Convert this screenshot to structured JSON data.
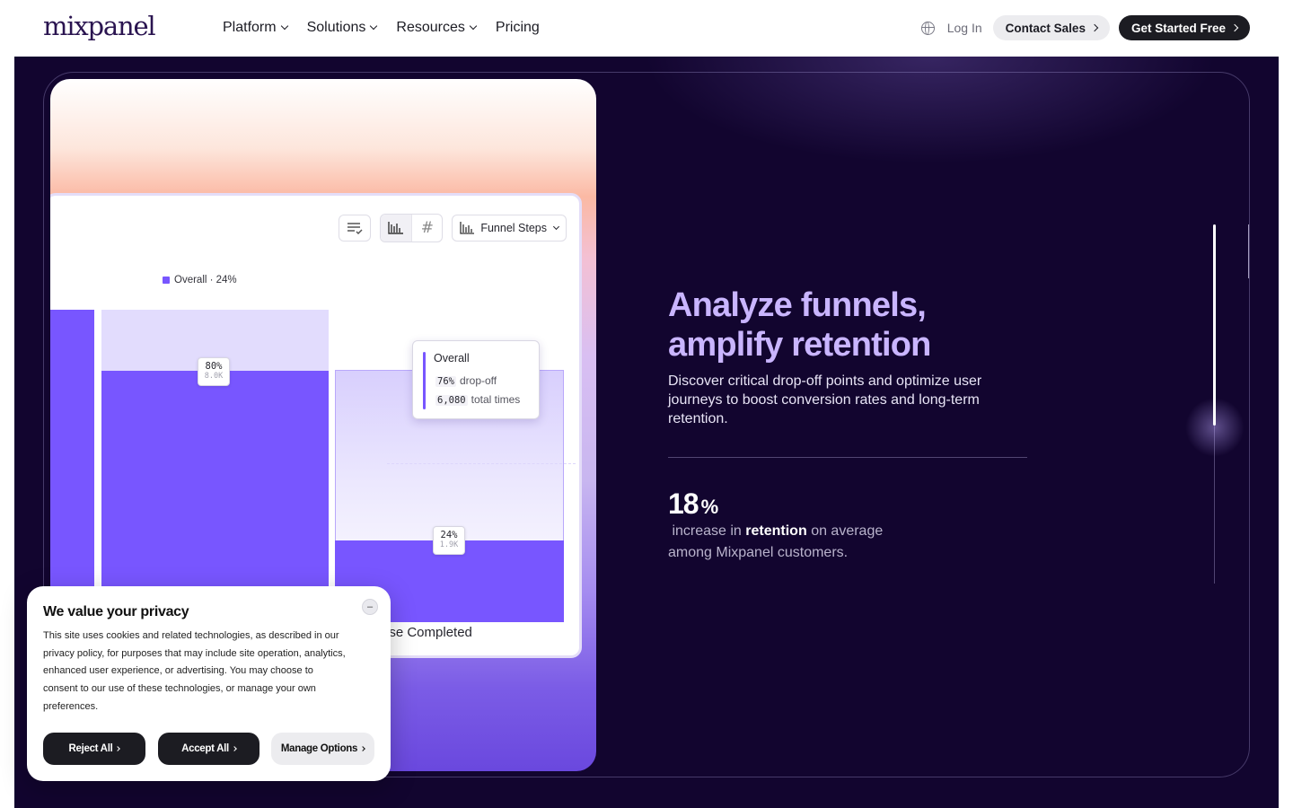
{
  "nav": {
    "logo": "mixpanel",
    "menu": [
      {
        "label": "Platform"
      },
      {
        "label": "Solutions"
      },
      {
        "label": "Resources"
      },
      {
        "label": "Pricing"
      }
    ],
    "login": "Log In",
    "contact": "Contact Sales",
    "start": "Get Started Free"
  },
  "chart": {
    "toolbar_select": "Funnel Steps",
    "legend": "Overall · 24%",
    "bar1_pct": "80%",
    "bar1_count": "8.0K",
    "bar2_pct": "24%",
    "bar2_count": "1.9K",
    "step_label": "ase Completed",
    "tooltip": {
      "title": "Overall",
      "dropoff_value": "76%",
      "dropoff_label": "drop-off",
      "total_value": "6,080",
      "total_label": "total times"
    }
  },
  "hero": {
    "title_line1": "Analyze funnels,",
    "title_line2": "amplify retention",
    "subtitle": "Discover critical drop-off points and optimize user journeys to boost conversion rates and long-term retention.",
    "stat_number": "18",
    "stat_unit": "%",
    "stat_pre": "increase in",
    "stat_bold": "retention",
    "stat_post": "on average among Mixpanel customers."
  },
  "cookie": {
    "title": "We value your privacy",
    "body": "This site uses cookies and related technologies, as described in our privacy policy, for purposes that may include site operation, analytics, enhanced user experience, or advertising. You may choose to consent to our use of these technologies, or manage your own preferences.",
    "close": "–",
    "reject": "Reject All",
    "accept": "Accept All",
    "manage": "Manage Options"
  },
  "colors": {
    "hero_bg": "#12052f",
    "accent_purple": "#7856ff",
    "title_lavender": "#c9b5ff"
  }
}
